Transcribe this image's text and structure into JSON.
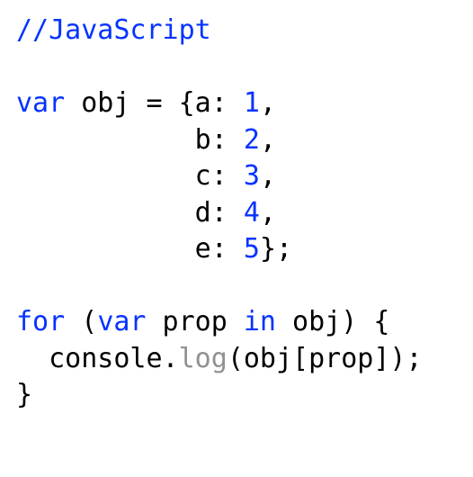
{
  "code": {
    "comment": "//JavaScript",
    "blank1": "",
    "l1_var": "var",
    "l1_rest": " obj = {a: ",
    "l1_num": "1",
    "l1_end": ",",
    "l2_pad": "           b: ",
    "l2_num": "2",
    "l2_end": ",",
    "l3_pad": "           c: ",
    "l3_num": "3",
    "l3_end": ",",
    "l4_pad": "           d: ",
    "l4_num": "4",
    "l4_end": ",",
    "l5_pad": "           e: ",
    "l5_num": "5",
    "l5_end": "};",
    "blank2": "",
    "l6_for": "for",
    "l6_sp1": " (",
    "l6_var": "var",
    "l6_sp2": " prop ",
    "l6_in": "in",
    "l6_sp3": " obj) {",
    "l7_a": "  console.",
    "l7_log": "log",
    "l7_b": "(obj[prop]);",
    "l8": "}"
  }
}
